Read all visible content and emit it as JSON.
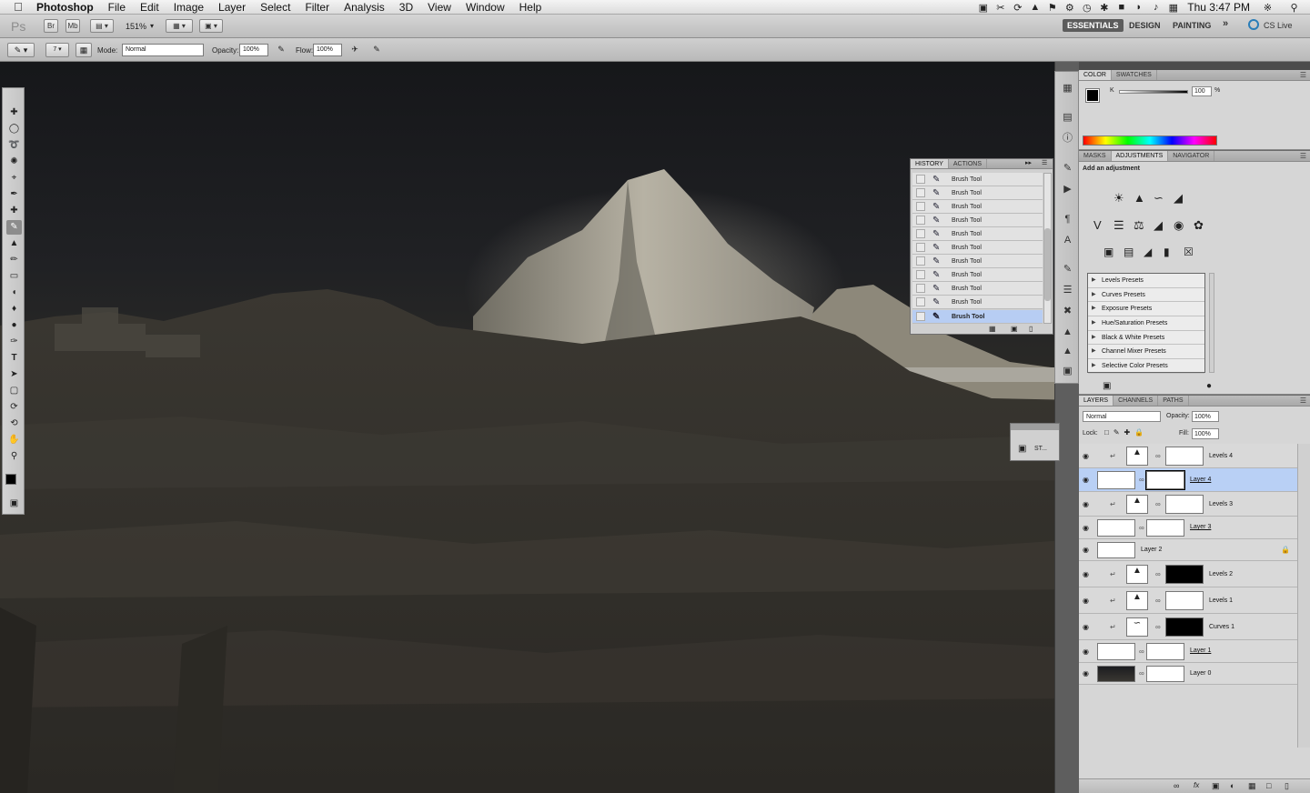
{
  "menubar": {
    "app": "Photoshop",
    "items": [
      "File",
      "Edit",
      "Image",
      "Layer",
      "Select",
      "Filter",
      "Analysis",
      "3D",
      "View",
      "Window",
      "Help"
    ],
    "clock": "Thu 3:47 PM"
  },
  "appbar": {
    "logo": "Ps",
    "br_label": "Br",
    "mb_label": "Mb",
    "zoom": "151%",
    "workspaces": [
      "ESSENTIALS",
      "DESIGN",
      "PAINTING"
    ],
    "more": "»",
    "cs_live": "CS Live"
  },
  "options": {
    "brush_size": "7",
    "mode_label": "Mode:",
    "mode_value": "Normal",
    "opacity_label": "Opacity:",
    "opacity_value": "100%",
    "flow_label": "Flow:",
    "flow_value": "100%"
  },
  "color_panel": {
    "tabs": [
      "COLOR",
      "SWATCHES"
    ],
    "channel": "K",
    "value": "100",
    "unit": "%"
  },
  "adjustments_panel": {
    "tabs": [
      "MASKS",
      "ADJUSTMENTS",
      "NAVIGATOR"
    ],
    "heading": "Add an adjustment",
    "presets": [
      "Levels Presets",
      "Curves Presets",
      "Exposure Presets",
      "Hue/Saturation Presets",
      "Black & White Presets",
      "Channel Mixer Presets",
      "Selective Color Presets"
    ]
  },
  "history_panel": {
    "tabs": [
      "HISTORY",
      "ACTIONS"
    ],
    "items": [
      "Brush Tool",
      "Brush Tool",
      "Brush Tool",
      "Brush Tool",
      "Brush Tool",
      "Brush Tool",
      "Brush Tool",
      "Brush Tool",
      "Brush Tool",
      "Brush Tool",
      "Brush Tool"
    ],
    "selected_index": 10
  },
  "st_panel": {
    "label": "ST..."
  },
  "layers_panel": {
    "tabs": [
      "LAYERS",
      "CHANNELS",
      "PATHS"
    ],
    "blend_mode": "Normal",
    "opacity_label": "Opacity:",
    "opacity_value": "100%",
    "lock_label": "Lock:",
    "fill_label": "Fill:",
    "fill_value": "100%",
    "layers": [
      {
        "name": "Levels 4",
        "kind": "adjustment",
        "mask": "white"
      },
      {
        "name": "Layer 4",
        "kind": "pixel",
        "mask": "white",
        "selected": true
      },
      {
        "name": "Levels 3",
        "kind": "adjustment",
        "mask": "white"
      },
      {
        "name": "Layer 3",
        "kind": "pixel",
        "mask": "white"
      },
      {
        "name": "Layer 2",
        "kind": "plain",
        "locked": true
      },
      {
        "name": "Levels 2",
        "kind": "adjustment",
        "mask": "black"
      },
      {
        "name": "Levels 1",
        "kind": "adjustment",
        "mask": "white"
      },
      {
        "name": "Curves 1",
        "kind": "curves",
        "mask": "black"
      },
      {
        "name": "Layer 1",
        "kind": "pixel",
        "mask": "white"
      },
      {
        "name": "Layer 0",
        "kind": "photo",
        "mask": "white"
      }
    ]
  }
}
